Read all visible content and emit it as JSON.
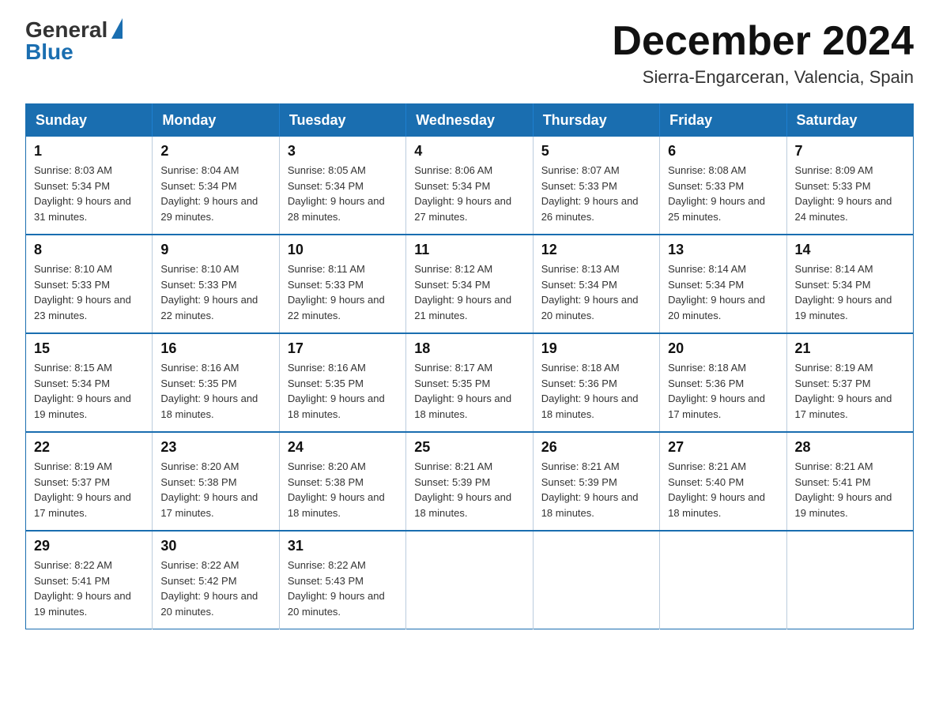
{
  "logo": {
    "general": "General",
    "blue": "Blue"
  },
  "title": "December 2024",
  "location": "Sierra-Engarceran, Valencia, Spain",
  "days_of_week": [
    "Sunday",
    "Monday",
    "Tuesday",
    "Wednesday",
    "Thursday",
    "Friday",
    "Saturday"
  ],
  "weeks": [
    [
      {
        "day": "1",
        "sunrise": "8:03 AM",
        "sunset": "5:34 PM",
        "daylight": "9 hours and 31 minutes."
      },
      {
        "day": "2",
        "sunrise": "8:04 AM",
        "sunset": "5:34 PM",
        "daylight": "9 hours and 29 minutes."
      },
      {
        "day": "3",
        "sunrise": "8:05 AM",
        "sunset": "5:34 PM",
        "daylight": "9 hours and 28 minutes."
      },
      {
        "day": "4",
        "sunrise": "8:06 AM",
        "sunset": "5:34 PM",
        "daylight": "9 hours and 27 minutes."
      },
      {
        "day": "5",
        "sunrise": "8:07 AM",
        "sunset": "5:33 PM",
        "daylight": "9 hours and 26 minutes."
      },
      {
        "day": "6",
        "sunrise": "8:08 AM",
        "sunset": "5:33 PM",
        "daylight": "9 hours and 25 minutes."
      },
      {
        "day": "7",
        "sunrise": "8:09 AM",
        "sunset": "5:33 PM",
        "daylight": "9 hours and 24 minutes."
      }
    ],
    [
      {
        "day": "8",
        "sunrise": "8:10 AM",
        "sunset": "5:33 PM",
        "daylight": "9 hours and 23 minutes."
      },
      {
        "day": "9",
        "sunrise": "8:10 AM",
        "sunset": "5:33 PM",
        "daylight": "9 hours and 22 minutes."
      },
      {
        "day": "10",
        "sunrise": "8:11 AM",
        "sunset": "5:33 PM",
        "daylight": "9 hours and 22 minutes."
      },
      {
        "day": "11",
        "sunrise": "8:12 AM",
        "sunset": "5:34 PM",
        "daylight": "9 hours and 21 minutes."
      },
      {
        "day": "12",
        "sunrise": "8:13 AM",
        "sunset": "5:34 PM",
        "daylight": "9 hours and 20 minutes."
      },
      {
        "day": "13",
        "sunrise": "8:14 AM",
        "sunset": "5:34 PM",
        "daylight": "9 hours and 20 minutes."
      },
      {
        "day": "14",
        "sunrise": "8:14 AM",
        "sunset": "5:34 PM",
        "daylight": "9 hours and 19 minutes."
      }
    ],
    [
      {
        "day": "15",
        "sunrise": "8:15 AM",
        "sunset": "5:34 PM",
        "daylight": "9 hours and 19 minutes."
      },
      {
        "day": "16",
        "sunrise": "8:16 AM",
        "sunset": "5:35 PM",
        "daylight": "9 hours and 18 minutes."
      },
      {
        "day": "17",
        "sunrise": "8:16 AM",
        "sunset": "5:35 PM",
        "daylight": "9 hours and 18 minutes."
      },
      {
        "day": "18",
        "sunrise": "8:17 AM",
        "sunset": "5:35 PM",
        "daylight": "9 hours and 18 minutes."
      },
      {
        "day": "19",
        "sunrise": "8:18 AM",
        "sunset": "5:36 PM",
        "daylight": "9 hours and 18 minutes."
      },
      {
        "day": "20",
        "sunrise": "8:18 AM",
        "sunset": "5:36 PM",
        "daylight": "9 hours and 17 minutes."
      },
      {
        "day": "21",
        "sunrise": "8:19 AM",
        "sunset": "5:37 PM",
        "daylight": "9 hours and 17 minutes."
      }
    ],
    [
      {
        "day": "22",
        "sunrise": "8:19 AM",
        "sunset": "5:37 PM",
        "daylight": "9 hours and 17 minutes."
      },
      {
        "day": "23",
        "sunrise": "8:20 AM",
        "sunset": "5:38 PM",
        "daylight": "9 hours and 17 minutes."
      },
      {
        "day": "24",
        "sunrise": "8:20 AM",
        "sunset": "5:38 PM",
        "daylight": "9 hours and 18 minutes."
      },
      {
        "day": "25",
        "sunrise": "8:21 AM",
        "sunset": "5:39 PM",
        "daylight": "9 hours and 18 minutes."
      },
      {
        "day": "26",
        "sunrise": "8:21 AM",
        "sunset": "5:39 PM",
        "daylight": "9 hours and 18 minutes."
      },
      {
        "day": "27",
        "sunrise": "8:21 AM",
        "sunset": "5:40 PM",
        "daylight": "9 hours and 18 minutes."
      },
      {
        "day": "28",
        "sunrise": "8:21 AM",
        "sunset": "5:41 PM",
        "daylight": "9 hours and 19 minutes."
      }
    ],
    [
      {
        "day": "29",
        "sunrise": "8:22 AM",
        "sunset": "5:41 PM",
        "daylight": "9 hours and 19 minutes."
      },
      {
        "day": "30",
        "sunrise": "8:22 AM",
        "sunset": "5:42 PM",
        "daylight": "9 hours and 20 minutes."
      },
      {
        "day": "31",
        "sunrise": "8:22 AM",
        "sunset": "5:43 PM",
        "daylight": "9 hours and 20 minutes."
      },
      null,
      null,
      null,
      null
    ]
  ]
}
